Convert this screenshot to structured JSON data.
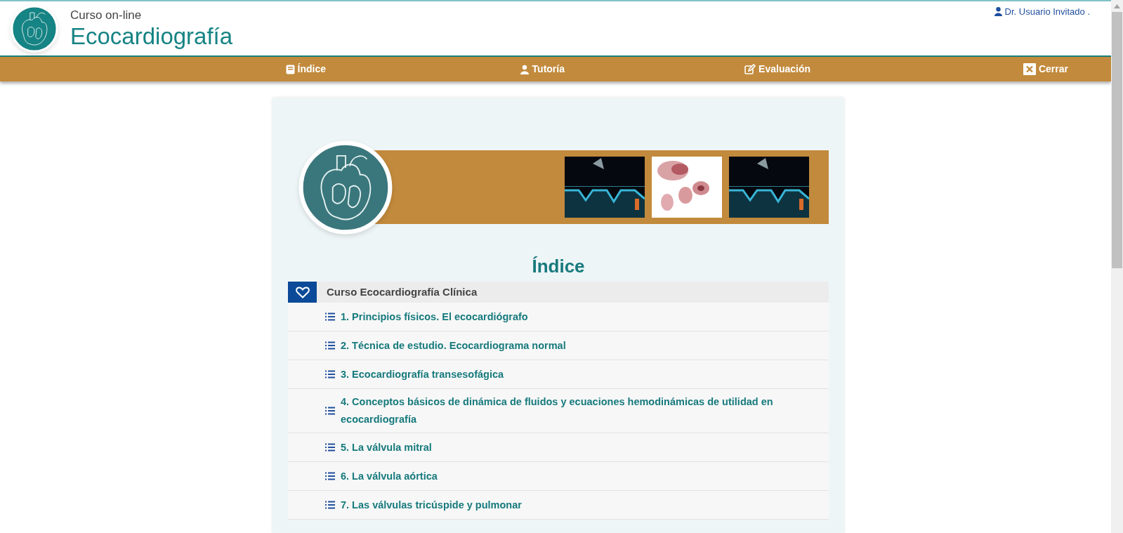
{
  "header": {
    "subtitle": "Curso  on-line",
    "title": "Ecocardiografía",
    "user": "Dr. Usuario Invitado ."
  },
  "nav": [
    {
      "kind": "book",
      "label": "Índice"
    },
    {
      "kind": "tutor",
      "label": "Tutoría"
    },
    {
      "kind": "edit",
      "label": "Evaluación"
    },
    {
      "kind": "close",
      "label": "Cerrar"
    }
  ],
  "index": {
    "title": "Índice",
    "section": "Curso Ecocardiografía Clínica",
    "items": [
      "1. Principios físicos. El ecocardiógrafo",
      "2. Técnica de estudio. Ecocardiograma normal",
      "3. Ecocardiografía transesofágica",
      "4. Conceptos básicos de dinámica de fluidos y ecuaciones hemodinámicas de utilidad en ecocardiografía",
      "5. La válvula mitral",
      "6. La válvula aórtica",
      "7. Las válvulas tricúspide y pulmonar"
    ]
  }
}
